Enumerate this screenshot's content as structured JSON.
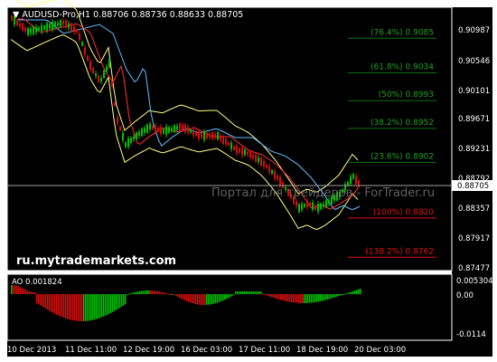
{
  "symbol_header": "AUDUSD-Pro,H1",
  "ohlc": "0.88706 0.88736 0.88633 0.88705",
  "watermark": "Портал для трейдеров - ForTrader.ru",
  "site_label": "ru.mytrademarkets.com",
  "colors": {
    "background": "#000000",
    "bull": "#00c000",
    "bear": "#d01010",
    "bollinger": "#ffff80",
    "ma_fast": "#ff3030",
    "ma_slow": "#60c0ff",
    "fib_line": "#107010",
    "fib_text": "#20a020",
    "fib_red": "#e01010",
    "axis_text": "#ffffff",
    "grid": "#808080"
  },
  "price_axis": {
    "labels": [
      "0.90987",
      "0.90546",
      "0.90101",
      "0.89671",
      "0.89231",
      "0.88792",
      "0.88705",
      "0.88357",
      "0.87917",
      "0.87477"
    ],
    "current": "0.88705"
  },
  "fib_levels": [
    {
      "text": "(76.4%) 0.9085",
      "price": 0.9085,
      "red": false
    },
    {
      "text": "(61.8%) 0.9034",
      "price": 0.9034,
      "red": false
    },
    {
      "text": "(50%) 0.8993",
      "price": 0.8993,
      "red": false
    },
    {
      "text": "(38.2%) 0.8952",
      "price": 0.8952,
      "red": false
    },
    {
      "text": "(23.6%) 0.8902",
      "price": 0.8902,
      "red": false
    },
    {
      "text": "(100%) 0.8820",
      "price": 0.882,
      "red": true
    },
    {
      "text": "(138.2%) 0.8762",
      "price": 0.8762,
      "red": true
    }
  ],
  "ao_panel": {
    "label": "AO 0.001824",
    "axis_labels": [
      "0.005304",
      "0.00",
      "-0.0114"
    ]
  },
  "time_axis": [
    "10 Dec 2013",
    "11 Dec 11:00",
    "12 Dec 19:00",
    "16 Dec 03:00",
    "17 Dec 11:00",
    "18 Dec 19:00",
    "20 Dec 03:00"
  ]
}
